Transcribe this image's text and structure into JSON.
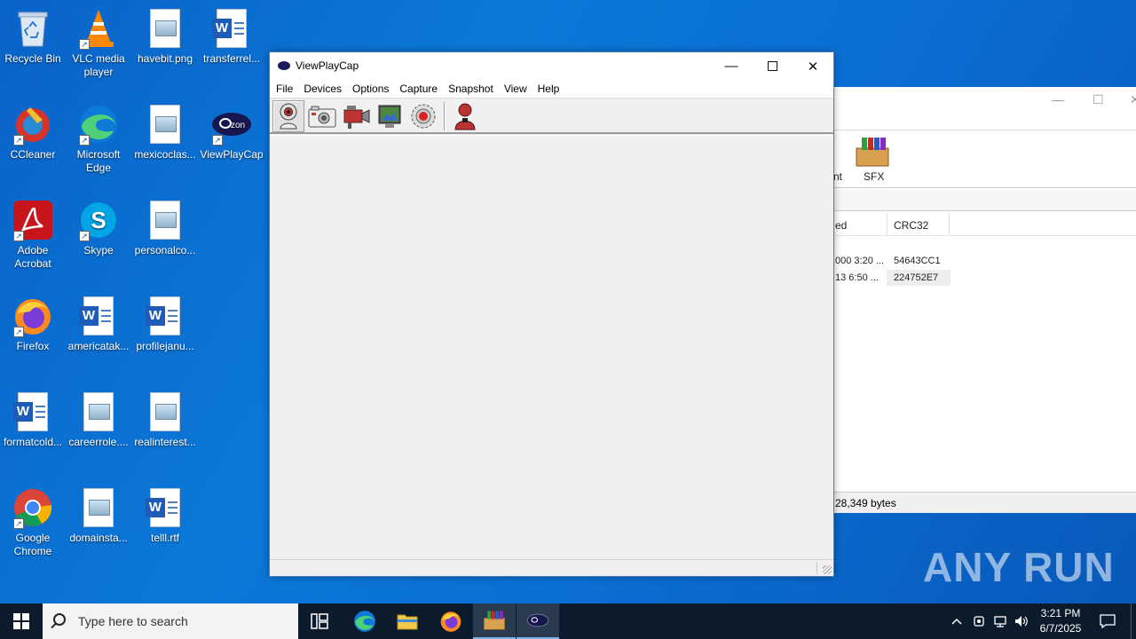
{
  "desktop": {
    "icons": [
      {
        "label": "Recycle Bin",
        "icon": "recycle-bin-icon"
      },
      {
        "label": "VLC media player",
        "icon": "vlc-icon"
      },
      {
        "label": "havebit.png",
        "icon": "image-file-icon"
      },
      {
        "label": "transferrel...",
        "icon": "word-doc-icon"
      },
      {
        "label": "CCleaner",
        "icon": "ccleaner-icon"
      },
      {
        "label": "Microsoft Edge",
        "icon": "edge-icon"
      },
      {
        "label": "mexicoclas...",
        "icon": "image-file-icon"
      },
      {
        "label": "ViewPlayCap",
        "icon": "viewplaycap-icon"
      },
      {
        "label": "Adobe Acrobat",
        "icon": "acrobat-icon"
      },
      {
        "label": "Skype",
        "icon": "skype-icon"
      },
      {
        "label": "personalco...",
        "icon": "image-file-icon"
      },
      {
        "label": "Firefox",
        "icon": "firefox-icon"
      },
      {
        "label": "americatak...",
        "icon": "word-doc-icon"
      },
      {
        "label": "profilejanu...",
        "icon": "word-doc-icon"
      },
      {
        "label": "formatcold...",
        "icon": "word-doc-icon"
      },
      {
        "label": "careerrole....",
        "icon": "image-file-icon"
      },
      {
        "label": "realinterest...",
        "icon": "image-file-icon"
      },
      {
        "label": "Google Chrome",
        "icon": "chrome-icon"
      },
      {
        "label": "domainsta...",
        "icon": "image-file-icon"
      },
      {
        "label": "telll.rtf",
        "icon": "word-doc-icon"
      }
    ]
  },
  "background_window": {
    "toolbar_partial_label": "nt",
    "sfx_label": "SFX",
    "columns": [
      "ed",
      "CRC32"
    ],
    "rows": [
      {
        "modified": "000 3:20 ...",
        "crc": "54643CC1"
      },
      {
        "modified": "13 6:50 ...",
        "crc": "224752E7"
      }
    ],
    "status": "28,349 bytes"
  },
  "window": {
    "title": "ViewPlayCap",
    "menu": [
      "File",
      "Devices",
      "Options",
      "Capture",
      "Snapshot",
      "View",
      "Help"
    ],
    "toolbar": [
      "webcam-preview-icon",
      "snapshot-camera-icon",
      "video-camera-icon",
      "video-settings-icon",
      "record-icon",
      "user-icon"
    ]
  },
  "watermark": "ANY RUN",
  "taskbar": {
    "search_placeholder": "Type here to search",
    "time": "3:21 PM",
    "date": "6/7/2025"
  }
}
